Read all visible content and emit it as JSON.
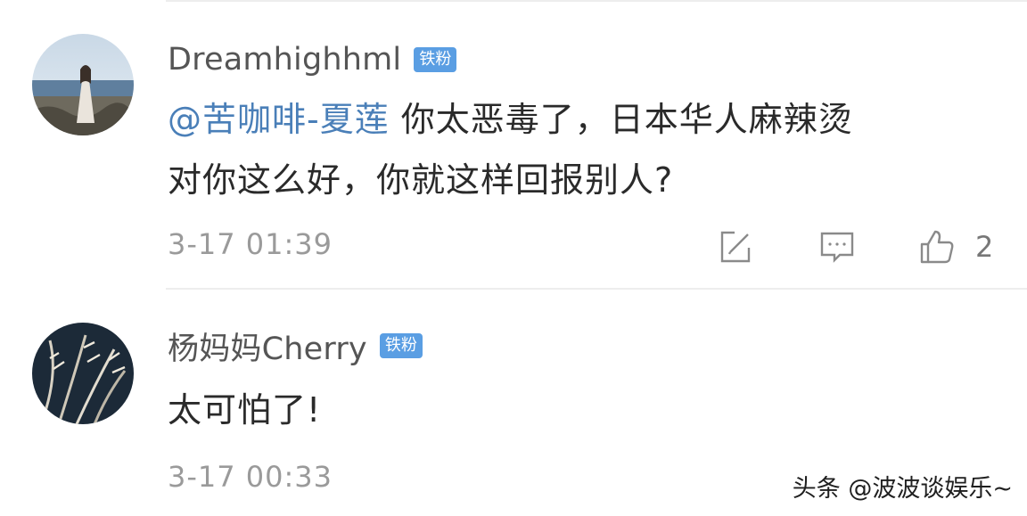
{
  "comments": [
    {
      "username": "Dreamhighhml",
      "badge": "铁粉",
      "mention": "@苦咖啡-夏莲",
      "text_after_mention": " 你太恶毒了，日本华人麻辣烫",
      "text_line2": "对你这么好，你就这样回报别人?",
      "timestamp": "3-17 01:39",
      "like_count": "2"
    },
    {
      "username": "杨妈妈Cherry",
      "badge": "铁粉",
      "text": "太可怕了!",
      "timestamp": "3-17 00:33"
    }
  ],
  "watermark": "头条 @波波谈娱乐~",
  "icons": [
    "edit-icon",
    "comment-icon",
    "like-icon"
  ],
  "colors": {
    "badge": "#5a9ee3",
    "mention": "#4a7fb8",
    "timestamp": "#9a9a9a"
  }
}
